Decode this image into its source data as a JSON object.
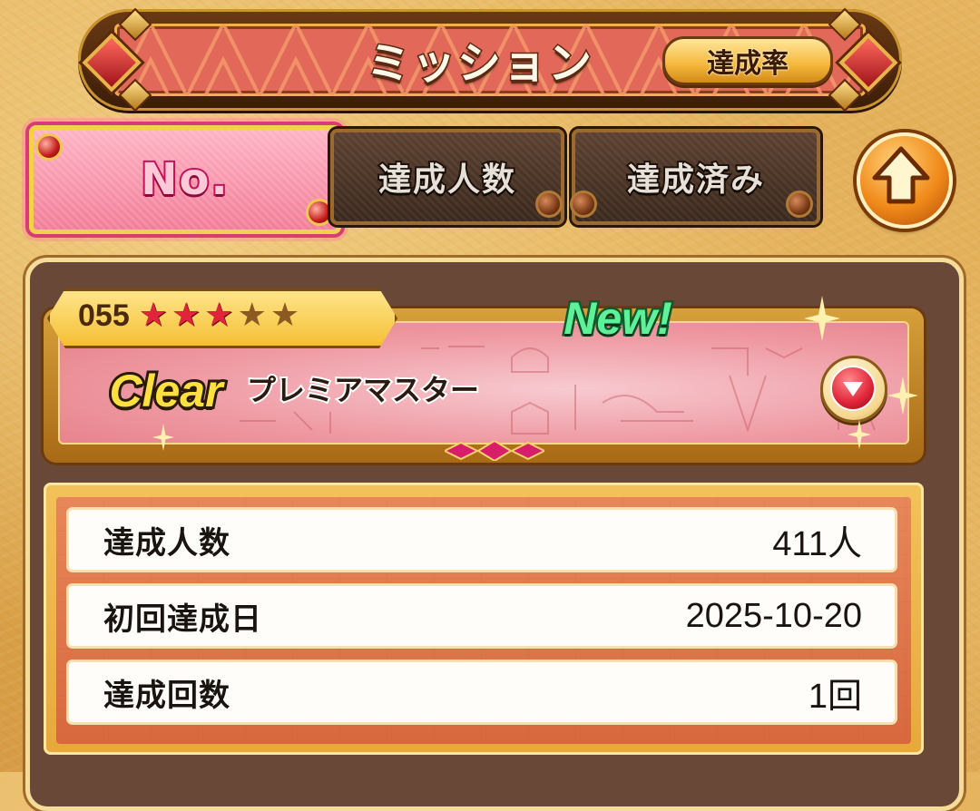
{
  "header": {
    "title": "ミッション",
    "rate_button_label": "達成率"
  },
  "tabs": [
    {
      "label": "No.",
      "active": true
    },
    {
      "label": "達成人数",
      "active": false
    },
    {
      "label": "達成済み",
      "active": false
    }
  ],
  "mission": {
    "number": "055",
    "stars_filled": 3,
    "stars_total": 5,
    "new_label": "New!",
    "status_label": "Clear",
    "title": "プレミアマスター"
  },
  "stats": [
    {
      "label": "達成人数",
      "value": "411人"
    },
    {
      "label": "初回達成日",
      "value": "2025-10-20"
    },
    {
      "label": "達成回数",
      "value": "1回"
    }
  ],
  "colors": {
    "banner": "#e2685a",
    "active_tab": "#f27d98",
    "star_on": "#e0243a",
    "new_badge": "#5ff09a",
    "clear_badge": "#ffe040"
  },
  "icons": {
    "up_button": "arrow-up-icon",
    "expand_button": "triangle-down-icon"
  }
}
